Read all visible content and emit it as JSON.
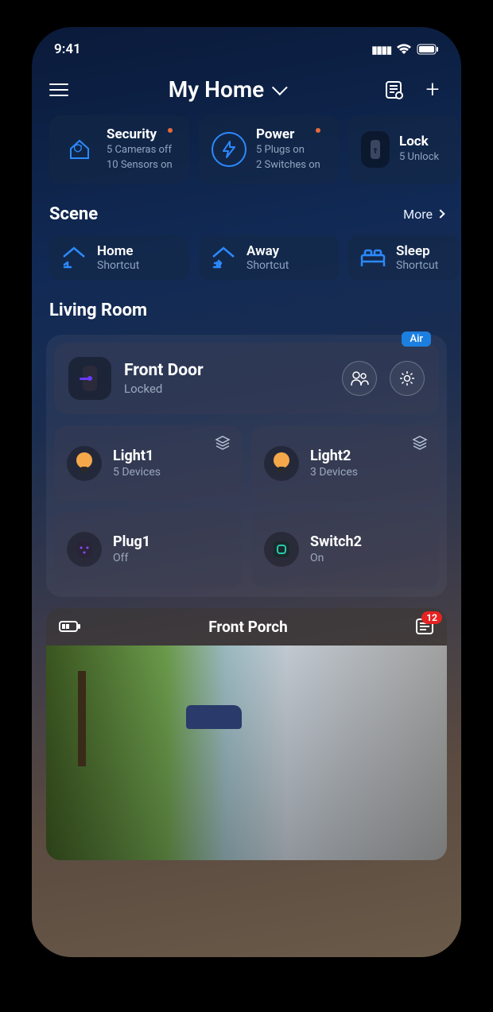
{
  "status": {
    "time": "9:41"
  },
  "header": {
    "title": "My Home"
  },
  "quick_cards": [
    {
      "title": "Security",
      "line1": "5 Cameras off",
      "line2": "10 Sensors on",
      "icon": "home-shield-icon",
      "alert": true
    },
    {
      "title": "Power",
      "line1": "5 Plugs on",
      "line2": "2 Switches on",
      "icon": "bolt-icon",
      "alert": true
    },
    {
      "title": "Lock",
      "line1": "5 Unlock",
      "line2": "",
      "icon": "lock-icon",
      "alert": false
    }
  ],
  "scene": {
    "heading": "Scene",
    "more_label": "More",
    "items": [
      {
        "name": "Home",
        "sub": "Shortcut",
        "icon": "home-in-icon"
      },
      {
        "name": "Away",
        "sub": "Shortcut",
        "icon": "home-out-icon"
      },
      {
        "name": "Sleep",
        "sub": "Shortcut",
        "icon": "bed-icon"
      }
    ]
  },
  "room": {
    "name": "Living Room",
    "badge": "Air",
    "main_device": {
      "name": "Front Door",
      "status": "Locked"
    },
    "devices": [
      {
        "name": "Light1",
        "sub": "5 Devices",
        "icon": "bulb-icon",
        "stack": true
      },
      {
        "name": "Light2",
        "sub": "3 Devices",
        "icon": "bulb-icon",
        "stack": true
      },
      {
        "name": "Plug1",
        "sub": "Off",
        "icon": "plug-icon",
        "stack": false
      },
      {
        "name": "Switch2",
        "sub": "On",
        "icon": "switch-icon",
        "stack": false
      }
    ]
  },
  "camera": {
    "title": "Front Porch",
    "badge_count": "12"
  }
}
